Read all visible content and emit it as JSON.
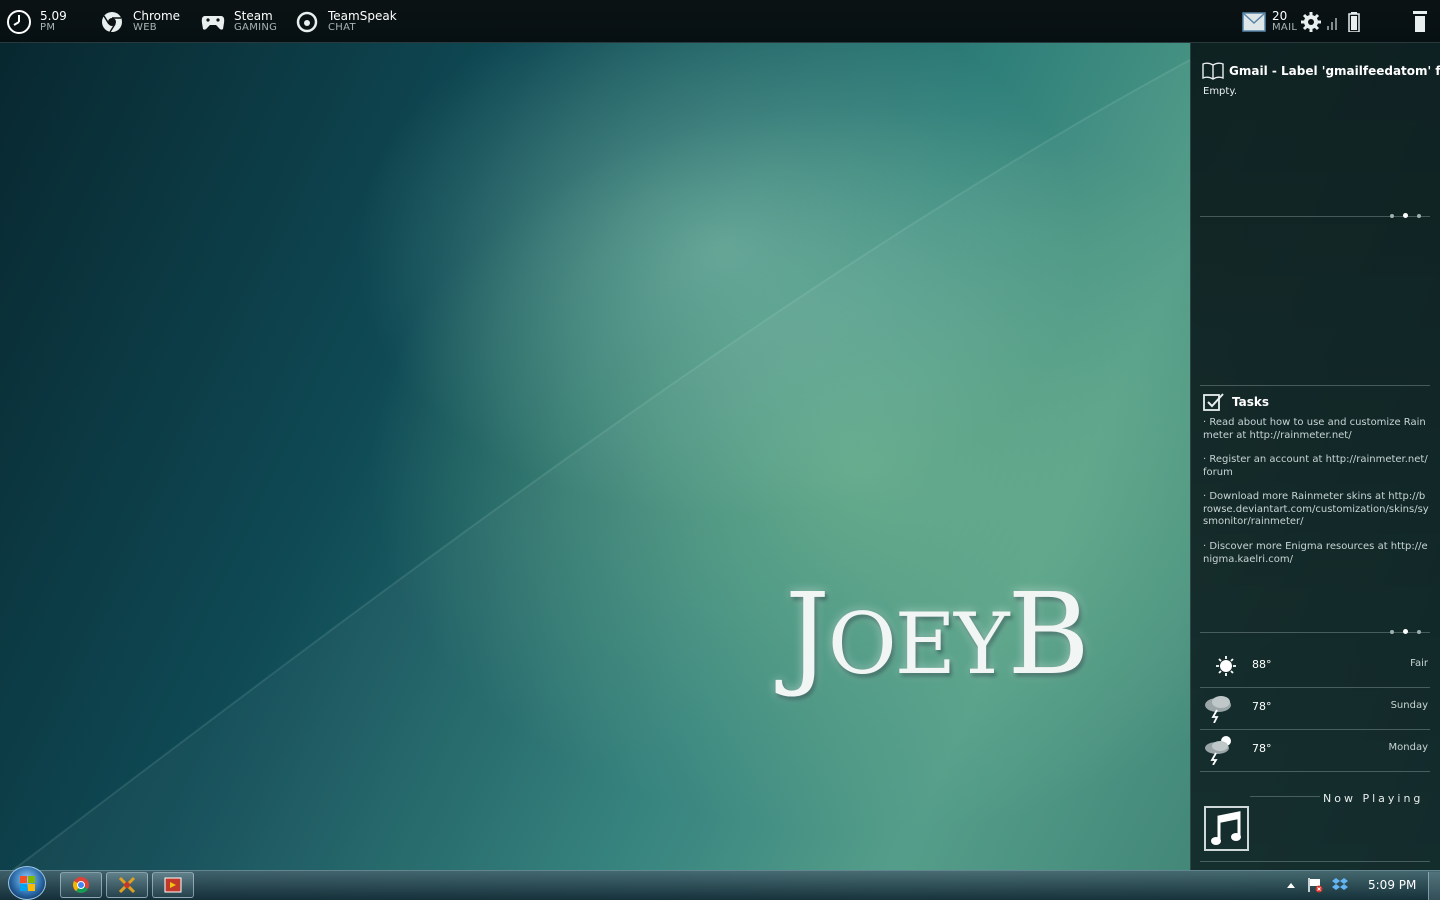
{
  "topbar": {
    "clock": {
      "time": "5.09",
      "period": "PM"
    },
    "launchers": [
      {
        "name": "Chrome",
        "sub": "WEB"
      },
      {
        "name": "Steam",
        "sub": "GAMING"
      },
      {
        "name": "TeamSpeak",
        "sub": "CHAT"
      }
    ],
    "mail": {
      "count": "20",
      "label": "MAIL"
    }
  },
  "gmail": {
    "title": "Gmail - Label 'gmailfeedatom' fo...",
    "status": "Empty."
  },
  "tasks": {
    "title": "Tasks",
    "items": [
      "· Read about how to use and customize Rainmeter at http://rainmeter.net/",
      "· Register an account at http://rainmeter.net/forum",
      "· Download more Rainmeter skins at http://browse.deviantart.com/customization/skins/sysmonitor/rainmeter/",
      "· Discover more Enigma resources at http://enigma.kaelri.com/"
    ]
  },
  "weather": [
    {
      "temp": "88°",
      "desc": "Fair",
      "icon": "sun-icon"
    },
    {
      "temp": "78°",
      "desc": "Sunday",
      "icon": "storm-icon"
    },
    {
      "temp": "78°",
      "desc": "Monday",
      "icon": "storm-sun-icon"
    }
  ],
  "now_playing": {
    "label": "Now Playing"
  },
  "wallpaper": {
    "logo_text": "JoeyB"
  },
  "taskbar": {
    "clock": "5:09 PM",
    "apps": [
      "chrome-icon",
      "tools-icon",
      "media-icon"
    ]
  },
  "colors": {
    "accent": "#4e9a86",
    "panel": "#0e2022"
  }
}
